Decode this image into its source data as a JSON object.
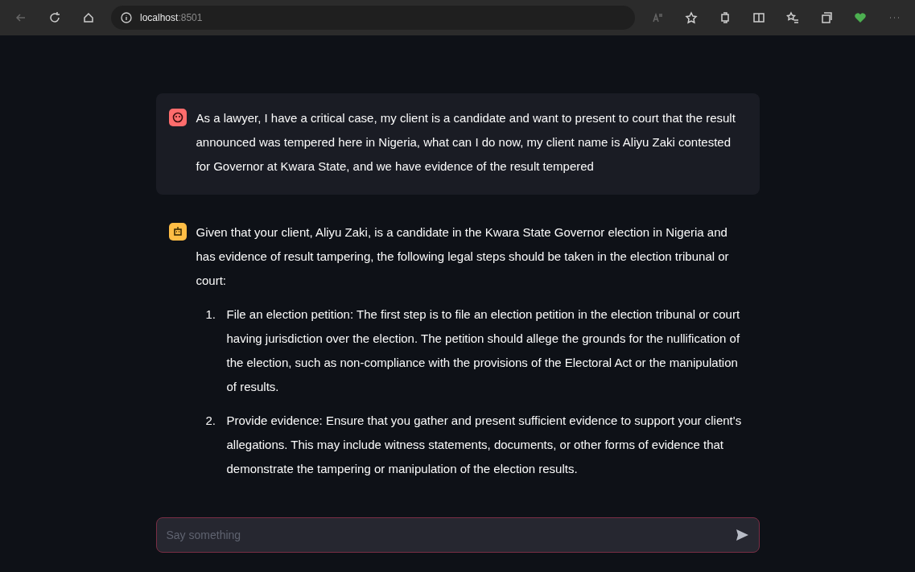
{
  "browser": {
    "address": "localhost",
    "port": ":8501"
  },
  "messages": [
    {
      "kind": "user",
      "text": "As a lawyer, I have a critical case, my client is a candidate and want to present to court that the result announced was tempered here in Nigeria, what can I do now, my client name is Aliyu Zaki contested for Governor at Kwara State, and we have evidence of the result tempered"
    },
    {
      "kind": "assistant",
      "text": "Given that your client, Aliyu Zaki, is a candidate in the Kwara State Governor election in Nigeria and has evidence of result tampering, the following legal steps should be taken in the election tribunal or court:",
      "list": [
        {
          "number": "1.",
          "text": "File an election petition: The first step is to file an election petition in the election tribunal or court having jurisdiction over the election. The petition should allege the grounds for the nullification of the election, such as non-compliance with the provisions of the Electoral Act or the manipulation of results."
        },
        {
          "number": "2.",
          "text": "Provide evidence: Ensure that you gather and present sufficient evidence to support your client's allegations. This may include witness statements, documents, or other forms of evidence that demonstrate the tampering or manipulation of the election results."
        }
      ]
    }
  ],
  "chat_input": {
    "placeholder": "Say something"
  }
}
